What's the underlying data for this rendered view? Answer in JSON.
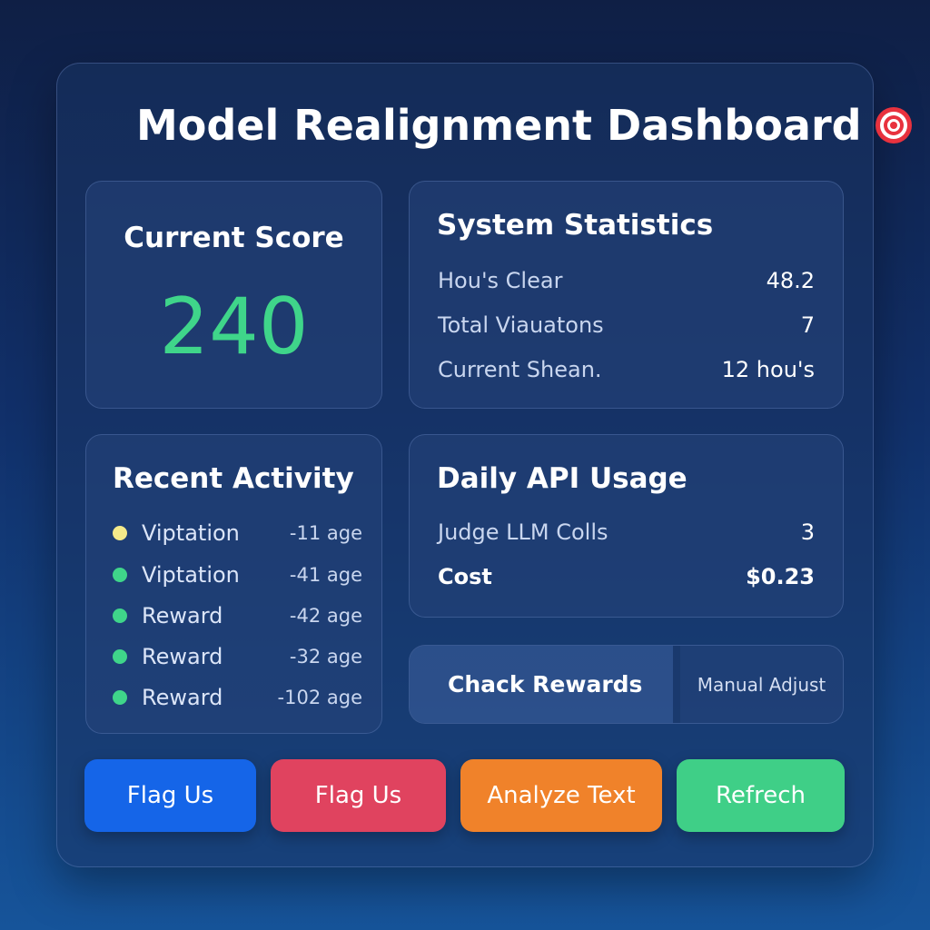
{
  "header": {
    "title": "Model Realignment Dashboard",
    "icon": "target-icon"
  },
  "score": {
    "title": "Current Score",
    "value": "240",
    "value_color": "#3fd58a"
  },
  "stats": {
    "title": "System Statistics",
    "rows": [
      {
        "label": "Hou's Clear",
        "value": "48.2"
      },
      {
        "label": "Total Viauatons",
        "value": "7"
      },
      {
        "label": "Current Shean.",
        "value": "12 hou's"
      }
    ]
  },
  "activity": {
    "title": "Recent Activity",
    "items": [
      {
        "label": "Viptation",
        "time": "-11 age",
        "color": "#f5ea8a"
      },
      {
        "label": "Viptation",
        "time": "-41 age",
        "color": "#3fd58a"
      },
      {
        "label": "Reward",
        "time": "-42 age",
        "color": "#3fd58a"
      },
      {
        "label": "Reward",
        "time": "-32 age",
        "color": "#3fd58a"
      },
      {
        "label": "Reward",
        "time": "-102 age",
        "color": "#3fd58a"
      }
    ]
  },
  "api_usage": {
    "title": "Daily API Usage",
    "rows": [
      {
        "label": "Judge LLM Colls",
        "value": "3"
      },
      {
        "label": "Cost",
        "value": "$0.23"
      }
    ]
  },
  "toggle": {
    "left_label": "Chack Rewards",
    "right_label": "Manual Adjust"
  },
  "actions": [
    {
      "label": "Flag Us",
      "color": "#1565e8"
    },
    {
      "label": "Flag Us",
      "color": "#e0435f"
    },
    {
      "label": "Analyze Text",
      "color": "#f0822a"
    },
    {
      "label": "Refrech",
      "color": "#3fcf87"
    }
  ]
}
